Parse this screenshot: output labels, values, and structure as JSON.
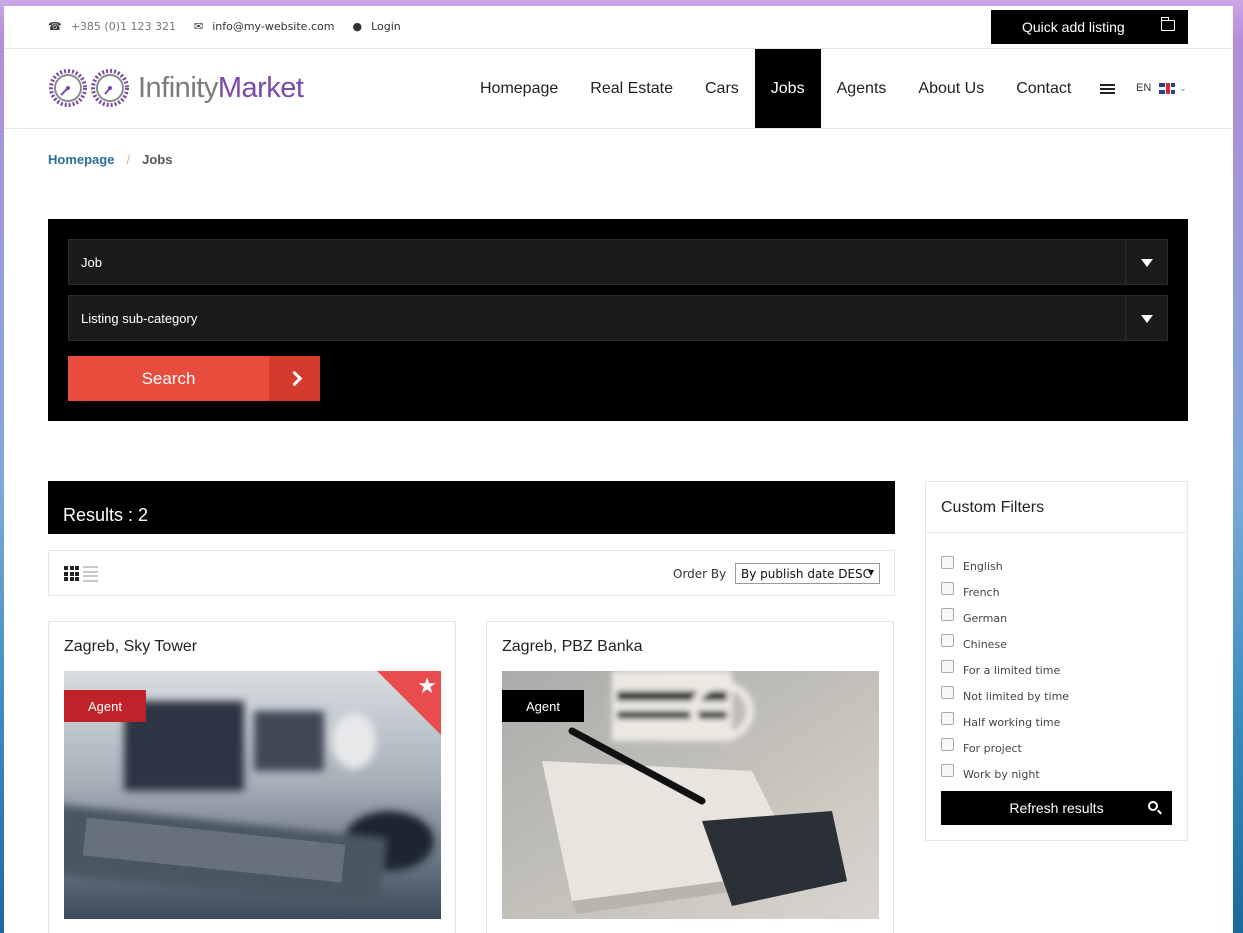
{
  "topbar": {
    "phone": "+385 (0)1 123 321",
    "email": "info@my-website.com",
    "login": "Login",
    "quick_add": "Quick add listing"
  },
  "logo": {
    "part1": "Infinity",
    "part2": "Market"
  },
  "nav": {
    "items": [
      "Homepage",
      "Real Estate",
      "Cars",
      "Jobs",
      "Agents",
      "About Us",
      "Contact"
    ],
    "active": "Jobs",
    "lang": "EN"
  },
  "breadcrumb": {
    "home": "Homepage",
    "separator": "/",
    "current": "Jobs"
  },
  "search": {
    "category_value": "Job",
    "subcategory_value": "Listing sub-category",
    "button": "Search"
  },
  "results": {
    "header": "Results : 2",
    "order_label": "Order By",
    "order_value": "By publish date DESC"
  },
  "cards": [
    {
      "title": "Zagreb, Sky Tower",
      "badge": "Agent",
      "badge_color": "#c0222a",
      "featured": true
    },
    {
      "title": "Zagreb, PBZ Banka",
      "badge": "Agent",
      "badge_color": "#000000",
      "featured": false
    }
  ],
  "sidebar": {
    "title": "Custom Filters",
    "filters": [
      "English",
      "French",
      "German",
      "Chinese",
      "For a limited time",
      "Not limited by time",
      "Half working time",
      "For project",
      "Work by night"
    ],
    "refresh": "Refresh results"
  },
  "colors": {
    "accent": "#e84c3d",
    "brand_purple": "#7a4aa8",
    "link": "#2a6d9e"
  }
}
